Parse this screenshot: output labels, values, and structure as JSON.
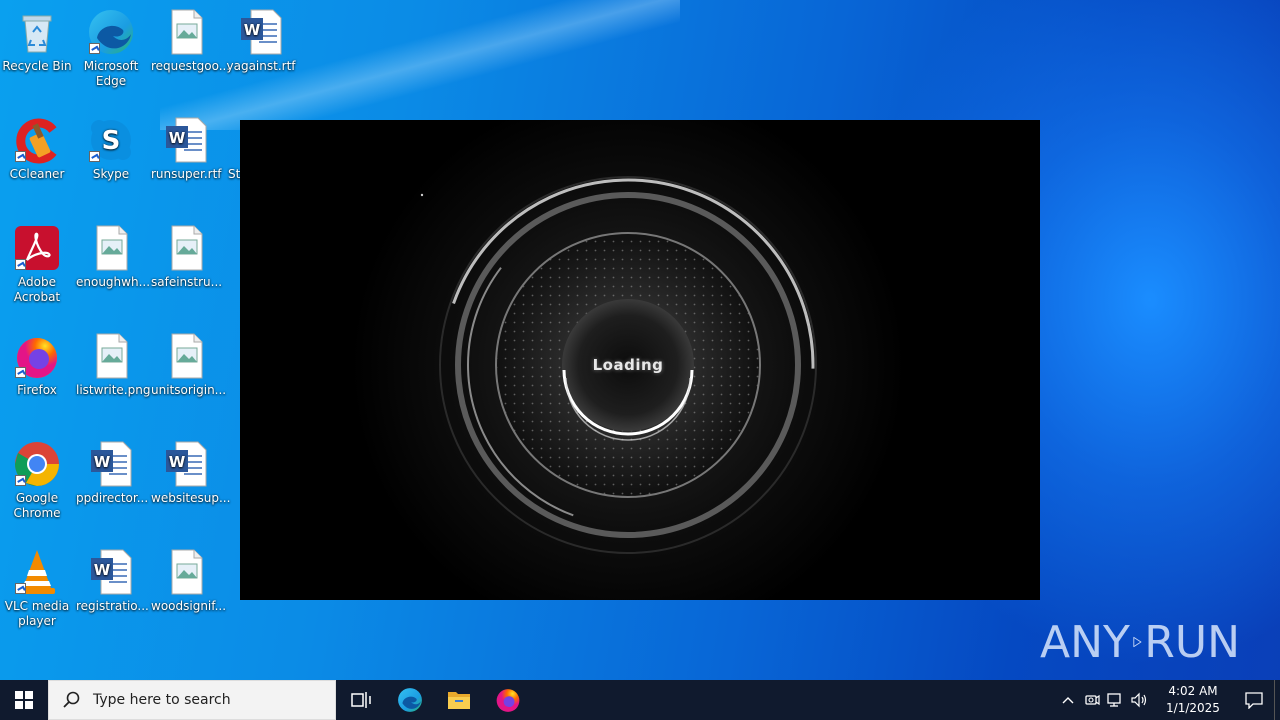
{
  "desktop": {
    "icons": [
      {
        "label": "Recycle Bin",
        "icon": "recycle-bin-icon"
      },
      {
        "label": "Microsoft Edge",
        "icon": "edge-icon"
      },
      {
        "label": "requestgoo...",
        "icon": "image-file-icon"
      },
      {
        "label": "yagainst.rtf",
        "icon": "word-document-icon"
      },
      {
        "label": "CCleaner",
        "icon": "ccleaner-icon"
      },
      {
        "label": "Skype",
        "icon": "skype-icon"
      },
      {
        "label": "runsuper.rtf",
        "icon": "word-document-icon"
      },
      {
        "label": "Str",
        "icon": "partial-file-icon"
      },
      {
        "label": "Adobe Acrobat",
        "icon": "acrobat-icon"
      },
      {
        "label": "enoughwh...",
        "icon": "image-file-icon"
      },
      {
        "label": "safeinstru...",
        "icon": "image-file-icon"
      },
      {
        "label": "Firefox",
        "icon": "firefox-icon"
      },
      {
        "label": "listwrite.png",
        "icon": "image-file-icon"
      },
      {
        "label": "unitsorigin...",
        "icon": "image-file-icon"
      },
      {
        "label": "Google Chrome",
        "icon": "chrome-icon"
      },
      {
        "label": "ppdirector...",
        "icon": "word-document-icon"
      },
      {
        "label": "websitesup...",
        "icon": "word-document-icon"
      },
      {
        "label": "VLC media player",
        "icon": "vlc-icon"
      },
      {
        "label": "registratio...",
        "icon": "word-document-icon"
      },
      {
        "label": "woodsignif...",
        "icon": "image-file-icon"
      }
    ]
  },
  "loader": {
    "text": "Loading"
  },
  "watermark": {
    "left": "ANY",
    "right": "RUN"
  },
  "taskbar": {
    "search_placeholder": "Type here to search",
    "clock_time": "4:02 AM",
    "clock_date": "1/1/2025",
    "pinned": [
      "task-view-icon",
      "edge-icon",
      "file-explorer-icon",
      "firefox-icon"
    ]
  },
  "colors": {
    "taskbar_bg": "#101a2e",
    "desktop_blue": "#0b8be6"
  }
}
